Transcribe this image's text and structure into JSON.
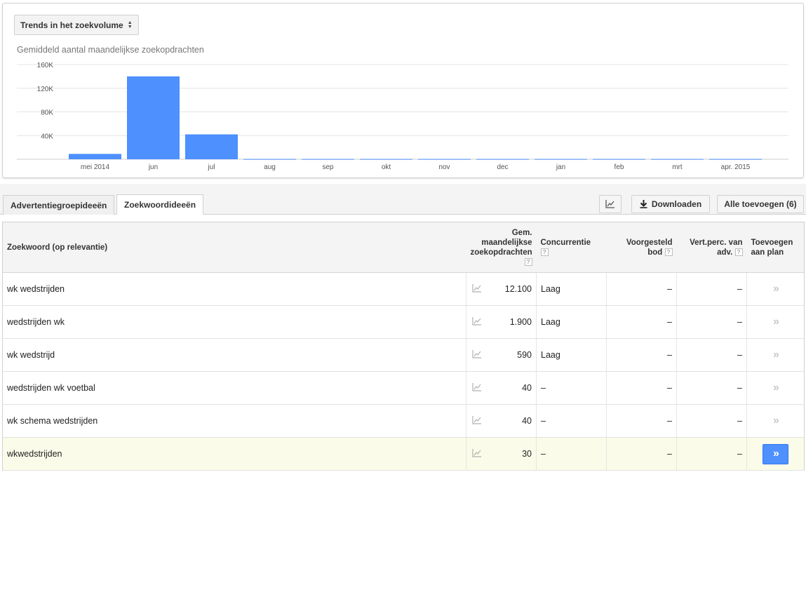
{
  "chart_panel": {
    "metric_select_label": "Trends in het zoekvolume",
    "subtitle": "Gemiddeld aantal maandelijkse zoekopdrachten"
  },
  "chart_data": {
    "type": "bar",
    "categories": [
      "mei 2014",
      "jun",
      "jul",
      "aug",
      "sep",
      "okt",
      "nov",
      "dec",
      "jan",
      "feb",
      "mrt",
      "apr. 2015"
    ],
    "values": [
      9000,
      140000,
      42000,
      400,
      400,
      400,
      400,
      400,
      400,
      400,
      400,
      400
    ],
    "ylim": [
      0,
      160000
    ],
    "yticks": [
      0,
      40000,
      80000,
      120000,
      160000
    ],
    "ytick_labels": [
      "",
      "40K",
      "80K",
      "120K",
      "160K"
    ],
    "title": "Gemiddeld aantal maandelijkse zoekopdrachten",
    "xlabel": "",
    "ylabel": "",
    "color": "#4d90fe",
    "grid": true
  },
  "tabs": [
    {
      "label": "Advertentiegroepideeën",
      "active": false
    },
    {
      "label": "Zoekwoordideeën",
      "active": true
    }
  ],
  "toolbar": {
    "chart_icon": "line-chart-icon",
    "download_label": "Downloaden",
    "download_icon": "download-icon",
    "add_all_label": "Alle toevoegen (6)"
  },
  "table": {
    "headers": {
      "keyword": "Zoekwoord (op relevantie)",
      "volume": [
        "Gem.",
        "maandelijkse",
        "zoekopdrachten"
      ],
      "competition": "Concurrentie",
      "bid": [
        "Voorgesteld",
        "bod"
      ],
      "ad_share": [
        "Vert.perc. van",
        "adv."
      ],
      "add": [
        "Toevoegen",
        "aan plan"
      ],
      "help_mark": "?"
    },
    "rows": [
      {
        "keyword": "wk wedstrijden",
        "volume": "12.100",
        "competition": "Laag",
        "bid": "–",
        "ad_share": "–",
        "add": "»"
      },
      {
        "keyword": "wedstrijden wk",
        "volume": "1.900",
        "competition": "Laag",
        "bid": "–",
        "ad_share": "–",
        "add": "»"
      },
      {
        "keyword": "wk wedstrijd",
        "volume": "590",
        "competition": "Laag",
        "bid": "–",
        "ad_share": "–",
        "add": "»"
      },
      {
        "keyword": "wedstrijden wk voetbal",
        "volume": "40",
        "competition": "–",
        "bid": "–",
        "ad_share": "–",
        "add": "»"
      },
      {
        "keyword": "wk schema wedstrijden",
        "volume": "40",
        "competition": "–",
        "bid": "–",
        "ad_share": "–",
        "add": "»"
      },
      {
        "keyword": "wkwedstrijden",
        "volume": "30",
        "competition": "–",
        "bid": "–",
        "ad_share": "–",
        "add": "»"
      }
    ],
    "highlighted_row": 5
  }
}
